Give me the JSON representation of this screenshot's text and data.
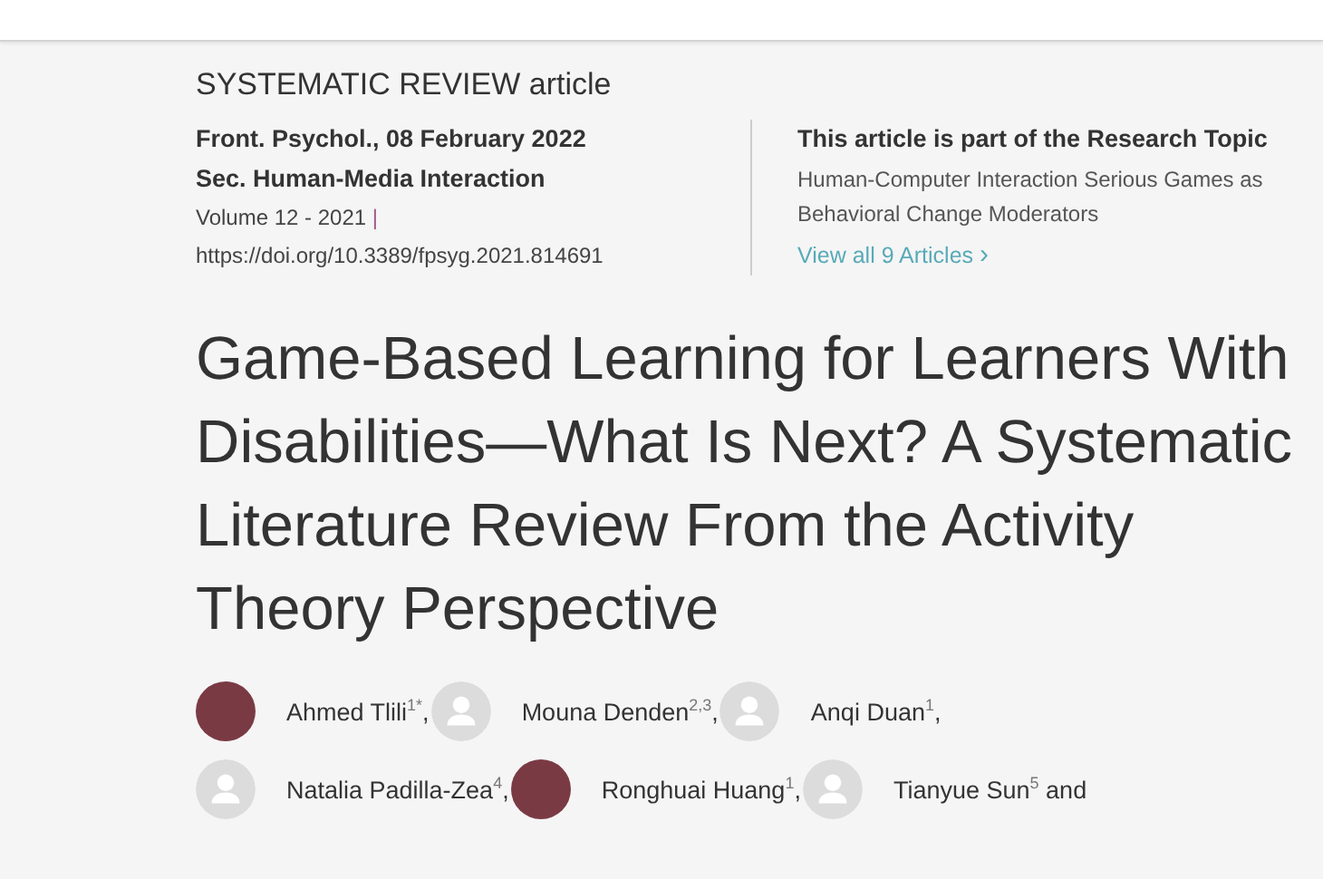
{
  "article_type": "SYSTEMATIC REVIEW article",
  "meta": {
    "journal_date": "Front. Psychol., 08 February 2022",
    "section": "Sec. Human-Media Interaction",
    "volume": "Volume 12 - 2021",
    "volume_separator": "|",
    "doi": "https://doi.org/10.3389/fpsyg.2021.814691"
  },
  "research_topic": {
    "heading": "This article is part of the Research Topic",
    "title": "Human-Computer Interaction Serious Games as Behavioral Change Moderators",
    "link": "View all 9 Articles",
    "link_icon": "›"
  },
  "title": "Game-Based Learning for Learners With Disabilities—What Is Next? A Systematic Literature Review From the Activity Theory Perspective",
  "authors": [
    {
      "kind": "photo",
      "name": "Ahmed Tlili$^{1*}$,"
    },
    {
      "kind": "placeholder",
      "name": "Mouna Denden$^{2,3}$,"
    },
    {
      "kind": "placeholder",
      "name": "Anqi Duan$^{1}$,"
    },
    {
      "kind": "placeholder",
      "name": "Natalia Padilla-Zea$^{4}$,"
    },
    {
      "kind": "photo",
      "name": "Ronghuai Huang$^{1}$,"
    },
    {
      "kind": "placeholder",
      "name": "Tianyue Sun$^{5}$ and"
    }
  ]
}
